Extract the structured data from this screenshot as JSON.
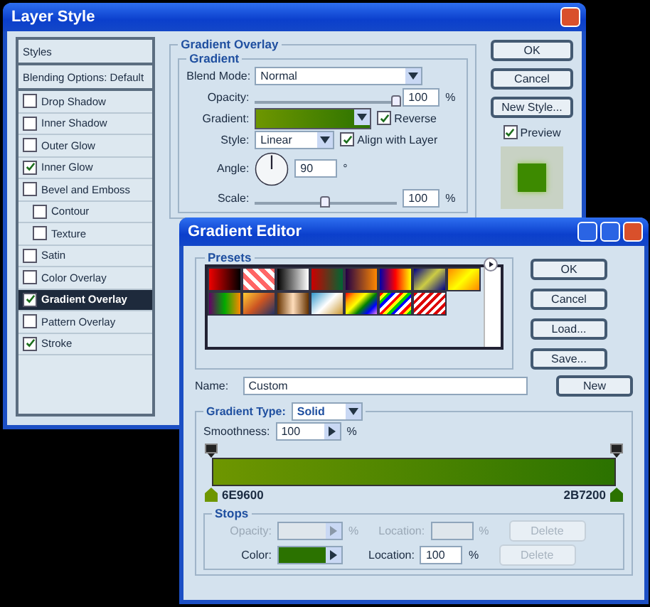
{
  "layer_style": {
    "title": "Layer Style",
    "styles_header": "Styles",
    "styles": [
      {
        "label": "Blending Options: Default",
        "kind": "header",
        "selected": false
      },
      {
        "label": "Drop Shadow",
        "kind": "check",
        "checked": false,
        "selected": false
      },
      {
        "label": "Inner Shadow",
        "kind": "check",
        "checked": false,
        "selected": false
      },
      {
        "label": "Outer Glow",
        "kind": "check",
        "checked": false,
        "selected": false
      },
      {
        "label": "Inner Glow",
        "kind": "check",
        "checked": true,
        "selected": false
      },
      {
        "label": "Bevel and Emboss",
        "kind": "check",
        "checked": false,
        "selected": false,
        "children": [
          {
            "label": "Contour",
            "kind": "check",
            "checked": false,
            "selected": false
          },
          {
            "label": "Texture",
            "kind": "check",
            "checked": false,
            "selected": false
          }
        ]
      },
      {
        "label": "Satin",
        "kind": "check",
        "checked": false,
        "selected": false
      },
      {
        "label": "Color Overlay",
        "kind": "check",
        "checked": false,
        "selected": false
      },
      {
        "label": "Gradient Overlay",
        "kind": "check",
        "checked": true,
        "selected": true
      },
      {
        "label": "Pattern Overlay",
        "kind": "check",
        "checked": false,
        "selected": false
      },
      {
        "label": "Stroke",
        "kind": "check",
        "checked": true,
        "selected": false
      }
    ],
    "section_title": "Gradient Overlay",
    "group_title": "Gradient",
    "blend_mode": {
      "label": "Blend Mode:",
      "value": "Normal"
    },
    "opacity": {
      "label": "Opacity:",
      "level": 1,
      "value": "100",
      "unit": "%"
    },
    "gradient": {
      "label": "Gradient:",
      "reverse": {
        "label": "Reverse",
        "checked": true
      }
    },
    "style": {
      "label": "Style:",
      "value": "Linear",
      "align": {
        "label": "Align with Layer",
        "checked": true
      }
    },
    "angle": {
      "label": "Angle:",
      "value": "90",
      "unit": "°"
    },
    "scale": {
      "label": "Scale:",
      "level": 0.5,
      "value": "100",
      "unit": "%"
    },
    "buttons": [
      "OK",
      "Cancel",
      "New Style..."
    ],
    "preview": {
      "label": "Preview",
      "checked": true
    }
  },
  "gradient_editor": {
    "title": "Gradient Editor",
    "presets_label": "Presets",
    "buttons": [
      "OK",
      "Cancel",
      "Load...",
      "Save..."
    ],
    "name": {
      "label": "Name:",
      "value": "Custom"
    },
    "new_button": "New",
    "type": {
      "label": "Gradient Type:",
      "value": "Solid"
    },
    "smoothness": {
      "label": "Smoothness:",
      "value": "100",
      "unit": "%"
    },
    "stops": [
      {
        "label": "6E9600",
        "color": "#6e9600"
      },
      {
        "label": "2B7200",
        "color": "#2b7200"
      }
    ],
    "stops_group": "Stops",
    "stop_rows": [
      {
        "kind": "opacity",
        "label": "Opacity:",
        "unit": "%",
        "location_label": "Location:",
        "location_unit": "%",
        "delete": "Delete",
        "disabled": true
      },
      {
        "kind": "color",
        "label": "Color:",
        "color": "#2b7200",
        "location_label": "Location:",
        "location": "100",
        "location_unit": "%",
        "delete": "Delete",
        "disabled": false
      }
    ]
  }
}
